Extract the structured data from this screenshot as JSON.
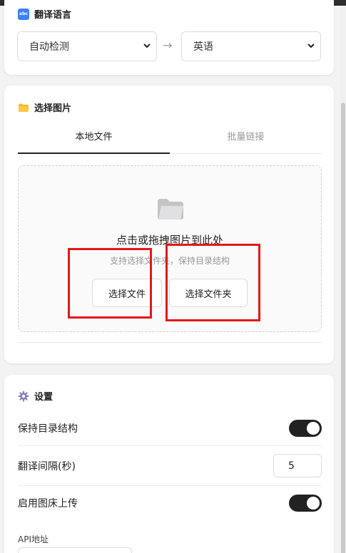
{
  "language_section": {
    "title": "翻译语言",
    "icon": "abc-icon",
    "icon_text": "abc",
    "source_language": "自动检测",
    "arrow": "→",
    "target_language": "英语"
  },
  "image_section": {
    "title": "选择图片",
    "icon": "folder-icon",
    "tabs": [
      "本地文件",
      "批量链接"
    ],
    "active_tab": "本地文件",
    "dropzone": {
      "title": "点击或拖拽图片到此处",
      "subtitle": "支持选择文件夹，保持目录结构",
      "select_file_label": "选择文件",
      "select_folder_label": "选择文件夹"
    }
  },
  "settings_section": {
    "title": "设置",
    "icon": "gear-icon",
    "keep_structure_label": "保持目录结构",
    "keep_structure_on": true,
    "interval_label": "翻译间隔(秒)",
    "interval_value": "5",
    "image_host_label": "启用图床上传",
    "image_host_on": true,
    "api_label": "API地址",
    "api_value": ""
  },
  "colors": {
    "highlight": "#e11919",
    "toggle_on": "#222222",
    "accent_icon": "#3b82f6"
  }
}
